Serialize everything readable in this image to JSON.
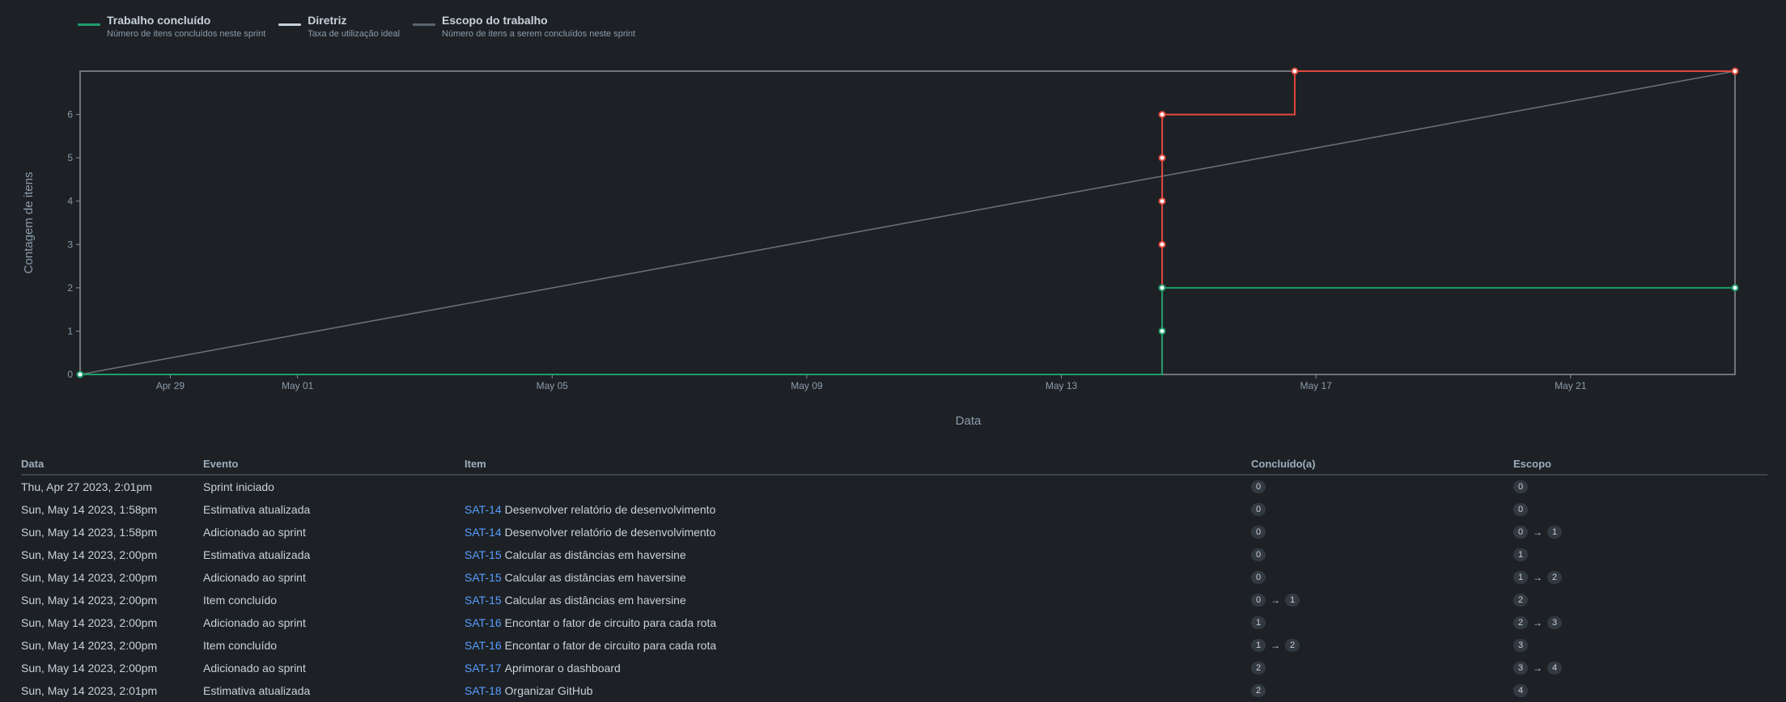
{
  "legend": [
    {
      "title": "Trabalho concluído",
      "subtitle": "Número de itens concluídos neste sprint",
      "color": "#1f9d6a"
    },
    {
      "title": "Diretriz",
      "subtitle": "Taxa de utilização ideal",
      "color": "#c7d1db"
    },
    {
      "title": "Escopo do trabalho",
      "subtitle": "Número de itens a serem concluídos neste sprint",
      "color": "#5a6470"
    }
  ],
  "chart_data": {
    "type": "line",
    "xlabel": "Data",
    "ylabel": "Contagem de itens",
    "x_ticks": [
      "Apr 29",
      "May 01",
      "May 05",
      "May 09",
      "May 13",
      "May 17",
      "May 21"
    ],
    "y_ticks": [
      0,
      1,
      2,
      3,
      4,
      5,
      6
    ],
    "x_range": [
      "2023-04-27 14:01",
      "2023-05-23 14:01"
    ],
    "ylim": [
      0,
      7
    ],
    "grid": false,
    "colors": {
      "completed": "#1f9d6a",
      "scope": "#e2483d",
      "guideline": "#6b6f73"
    },
    "series": [
      {
        "name": "Trabalho concluído",
        "step": true,
        "points": [
          {
            "x": "2023-04-27 14:01",
            "y": 0
          },
          {
            "x": "2023-05-14 14:00",
            "y": 1
          },
          {
            "x": "2023-05-14 14:00",
            "y": 2
          },
          {
            "x": "2023-05-23 14:01",
            "y": 2
          }
        ]
      },
      {
        "name": "Escopo do trabalho",
        "step": true,
        "points": [
          {
            "x": "2023-04-27 14:01",
            "y": 0
          },
          {
            "x": "2023-05-14 13:58",
            "y": 1
          },
          {
            "x": "2023-05-14 14:00",
            "y": 2
          },
          {
            "x": "2023-05-14 14:00",
            "y": 3
          },
          {
            "x": "2023-05-14 14:00",
            "y": 4
          },
          {
            "x": "2023-05-14 14:01",
            "y": 5
          },
          {
            "x": "2023-05-14 14:01",
            "y": 6
          },
          {
            "x": "2023-05-16 16:00",
            "y": 7
          },
          {
            "x": "2023-05-23 14:01",
            "y": 7
          }
        ]
      },
      {
        "name": "Diretriz",
        "points": [
          {
            "x": "2023-04-27 14:01",
            "y": 0
          },
          {
            "x": "2023-05-23 14:01",
            "y": 7
          }
        ]
      }
    ]
  },
  "table": {
    "headers": {
      "date": "Data",
      "event": "Evento",
      "item": "Item",
      "done": "Concluído(a)",
      "scope": "Escopo"
    },
    "rows": [
      {
        "date": "Thu, Apr 27 2023, 2:01pm",
        "event": "Sprint iniciado",
        "key": "",
        "summary": "",
        "done": [
          "0"
        ],
        "scope": [
          "0"
        ]
      },
      {
        "date": "Sun, May 14 2023, 1:58pm",
        "event": "Estimativa atualizada",
        "key": "SAT-14",
        "summary": "Desenvolver relatório de desenvolvimento",
        "done": [
          "0"
        ],
        "scope": [
          "0"
        ]
      },
      {
        "date": "Sun, May 14 2023, 1:58pm",
        "event": "Adicionado ao sprint",
        "key": "SAT-14",
        "summary": "Desenvolver relatório de desenvolvimento",
        "done": [
          "0"
        ],
        "scope": [
          "0",
          "1"
        ]
      },
      {
        "date": "Sun, May 14 2023, 2:00pm",
        "event": "Estimativa atualizada",
        "key": "SAT-15",
        "summary": "Calcular as distâncias em haversine",
        "done": [
          "0"
        ],
        "scope": [
          "1"
        ]
      },
      {
        "date": "Sun, May 14 2023, 2:00pm",
        "event": "Adicionado ao sprint",
        "key": "SAT-15",
        "summary": "Calcular as distâncias em haversine",
        "done": [
          "0"
        ],
        "scope": [
          "1",
          "2"
        ]
      },
      {
        "date": "Sun, May 14 2023, 2:00pm",
        "event": "Item concluído",
        "key": "SAT-15",
        "summary": "Calcular as distâncias em haversine",
        "done": [
          "0",
          "1"
        ],
        "scope": [
          "2"
        ]
      },
      {
        "date": "Sun, May 14 2023, 2:00pm",
        "event": "Adicionado ao sprint",
        "key": "SAT-16",
        "summary": "Encontar o fator de circuito para cada rota",
        "done": [
          "1"
        ],
        "scope": [
          "2",
          "3"
        ]
      },
      {
        "date": "Sun, May 14 2023, 2:00pm",
        "event": "Item concluído",
        "key": "SAT-16",
        "summary": "Encontar o fator de circuito para cada rota",
        "done": [
          "1",
          "2"
        ],
        "scope": [
          "3"
        ]
      },
      {
        "date": "Sun, May 14 2023, 2:00pm",
        "event": "Adicionado ao sprint",
        "key": "SAT-17",
        "summary": "Aprimorar o dashboard",
        "done": [
          "2"
        ],
        "scope": [
          "3",
          "4"
        ]
      },
      {
        "date": "Sun, May 14 2023, 2:01pm",
        "event": "Estimativa atualizada",
        "key": "SAT-18",
        "summary": "Organizar GitHub",
        "done": [
          "2"
        ],
        "scope": [
          "4"
        ]
      }
    ]
  }
}
